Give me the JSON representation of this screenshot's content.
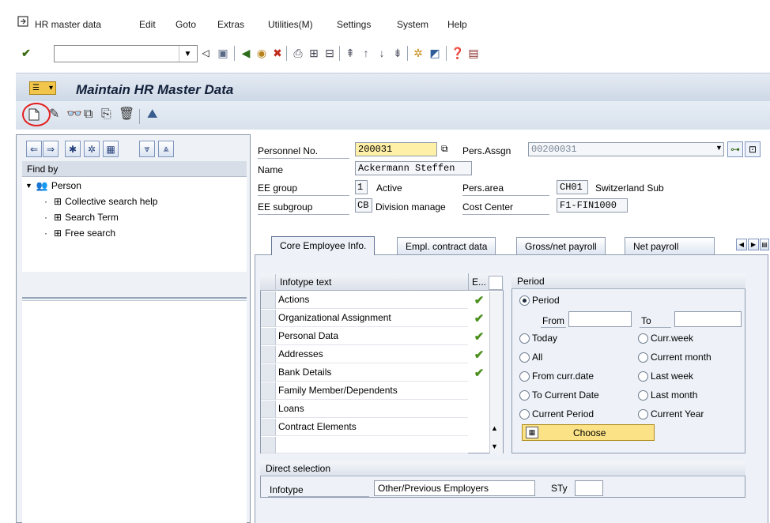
{
  "menu": {
    "items": [
      "HR master data",
      "Edit",
      "Goto",
      "Extras",
      "Utilities(M)",
      "Settings",
      "System",
      "Help"
    ]
  },
  "toolbar": {
    "command_field_value": ""
  },
  "page": {
    "title": "Maintain HR Master Data"
  },
  "left_panel": {
    "find_by_label": "Find by",
    "tree_root": "Person",
    "tree_items": [
      "Collective search help",
      "Search Term",
      "Free search"
    ]
  },
  "header": {
    "personnel_no_label": "Personnel No.",
    "personnel_no_value": "200031",
    "pers_assgn_label": "Pers.Assgn",
    "pers_assgn_value": "00200031",
    "name_label": "Name",
    "name_value": "Ackermann Steffen",
    "ee_group_label": "EE group",
    "ee_group_code": "1",
    "ee_group_text": "Active",
    "pers_area_label": "Pers.area",
    "pers_area_code": "CH01",
    "pers_area_text": "Switzerland Sub",
    "ee_subgroup_label": "EE subgroup",
    "ee_subgroup_code": "CB",
    "ee_subgroup_text": "Division manage",
    "cost_center_label": "Cost Center",
    "cost_center_value": "F1-FIN1000"
  },
  "tabs": [
    "Core Employee Info.",
    "Empl. contract data",
    "Gross/net payroll",
    "Net payroll"
  ],
  "infotype_table": {
    "col_header": "Infotype text",
    "col_exists_header": "E...",
    "rows": [
      {
        "text": "Actions",
        "exists": true
      },
      {
        "text": "Organizational Assignment",
        "exists": true
      },
      {
        "text": "Personal Data",
        "exists": true
      },
      {
        "text": "Addresses",
        "exists": true
      },
      {
        "text": "Bank Details",
        "exists": true
      },
      {
        "text": "Family Member/Dependents",
        "exists": false
      },
      {
        "text": "Loans",
        "exists": false
      },
      {
        "text": "Contract Elements",
        "exists": false
      }
    ]
  },
  "period": {
    "title": "Period",
    "period_option": "Period",
    "from_label": "From",
    "to_label": "To",
    "from_value": "",
    "to_value": "",
    "options_left": [
      "Today",
      "All",
      "From curr.date",
      "To Current Date",
      "Current Period"
    ],
    "options_right": [
      "Curr.week",
      "Current month",
      "Last week",
      "Last month",
      "Current Year"
    ],
    "choose_label": "Choose"
  },
  "direct_selection": {
    "title": "Direct selection",
    "infotype_label": "Infotype",
    "infotype_value": "Other/Previous Employers",
    "sty_label": "STy",
    "sty_value": ""
  }
}
